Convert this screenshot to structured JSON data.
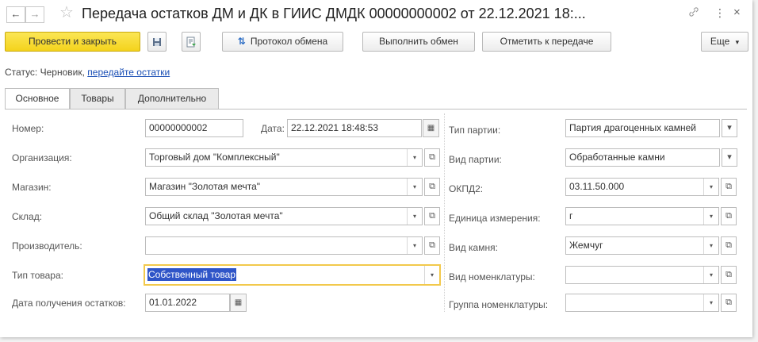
{
  "window": {
    "title": "Передача остатков ДМ и ДК в ГИИС ДМДК 00000000002 от 22.12.2021 18:...",
    "back_icon": "←",
    "forward_icon": "→",
    "star_icon": "☆",
    "link_icon": "🔗",
    "more_icon": "⋮",
    "close_icon": "×"
  },
  "toolbar": {
    "post_close_label": "Провести и закрыть",
    "save_icon": "💾",
    "report_icon": "📄",
    "exchange_protocol_label": "Протокол обмена",
    "exchange_protocol_icon": "⇅",
    "run_exchange_label": "Выполнить обмен",
    "mark_transfer_label": "Отметить к передаче",
    "more_label": "Еще",
    "more_arrow": "▾"
  },
  "status": {
    "prefix": "Статус:",
    "value": "Черновик,",
    "link": "передайте остатки"
  },
  "tabs": [
    {
      "label": "Основное"
    },
    {
      "label": "Товары"
    },
    {
      "label": "Дополнительно"
    }
  ],
  "form": {
    "number": {
      "label": "Номер:",
      "value": "00000000002"
    },
    "date": {
      "label": "Дата:",
      "value": "22.12.2021 18:48:53"
    },
    "organization": {
      "label": "Организация:",
      "value": "Торговый дом \"Комплексный\""
    },
    "store": {
      "label": "Магазин:",
      "value": "Магазин \"Золотая мечта\""
    },
    "warehouse": {
      "label": "Склад:",
      "value": "Общий склад \"Золотая мечта\""
    },
    "manufacturer": {
      "label": "Производитель:",
      "value": ""
    },
    "goods_type": {
      "label": "Тип товара:",
      "value": "Собственный товар"
    },
    "balance_date": {
      "label": "Дата получения остатков:",
      "value": "01.01.2022"
    },
    "batch_type": {
      "label": "Тип партии:",
      "value": "Партия драгоценных камней"
    },
    "batch_kind": {
      "label": "Вид партии:",
      "value": "Обработанные камни"
    },
    "okpd2": {
      "label": "ОКПД2:",
      "value": "03.11.50.000"
    },
    "unit": {
      "label": "Единица измерения:",
      "value": "г"
    },
    "stone_kind": {
      "label": "Вид камня:",
      "value": "Жемчуг"
    },
    "nomenclature_kind": {
      "label": "Вид номенклатуры:",
      "value": ""
    },
    "nomenclature_group": {
      "label": "Группа номенклатуры:",
      "value": ""
    }
  },
  "glyphs": {
    "dropdown": "▾",
    "open": "⧉",
    "calendar": "▦"
  },
  "colors": {
    "primary_button": "#f4d31c",
    "link": "#1a4fb5",
    "selection": "#2f55c8",
    "focus_border": "#f2c94c"
  }
}
